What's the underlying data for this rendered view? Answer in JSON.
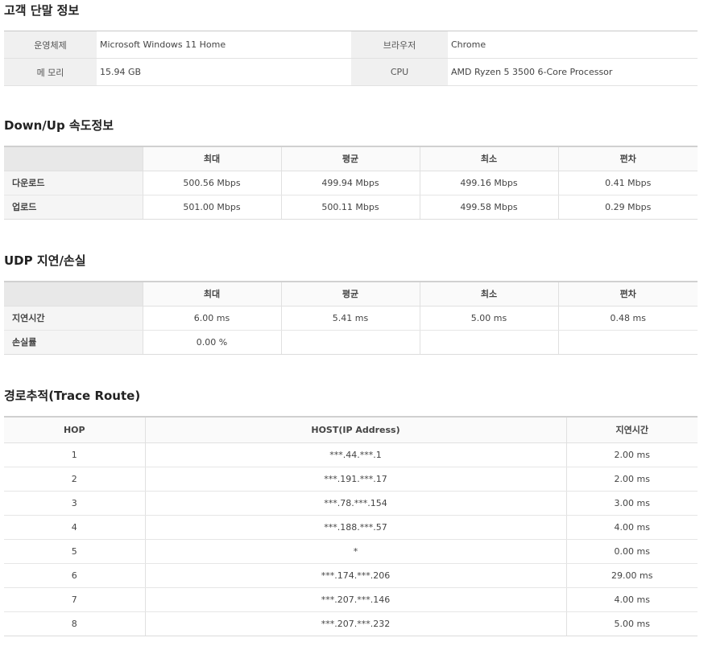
{
  "device": {
    "title": "고객 단말 정보",
    "rows": [
      {
        "k1": "운영체제",
        "v1": "Microsoft Windows 11 Home",
        "k2": "브라우저",
        "v2": "Chrome"
      },
      {
        "k1": "메 모리",
        "v1": "15.94 GB",
        "k2": "CPU",
        "v2": "AMD Ryzen 5 3500 6-Core Processor"
      }
    ]
  },
  "speed": {
    "title": "Down/Up 속도정보",
    "headers": [
      "최대",
      "평균",
      "최소",
      "편차"
    ],
    "rows": [
      {
        "label": "다운로드",
        "values": [
          "500.56 Mbps",
          "499.94 Mbps",
          "499.16 Mbps",
          "0.41 Mbps"
        ]
      },
      {
        "label": "업로드",
        "values": [
          "501.00 Mbps",
          "500.11 Mbps",
          "499.58 Mbps",
          "0.29 Mbps"
        ]
      }
    ]
  },
  "udp": {
    "title": "UDP 지연/손실",
    "headers": [
      "최대",
      "평균",
      "최소",
      "편차"
    ],
    "rows": [
      {
        "label": "지연시간",
        "values": [
          "6.00 ms",
          "5.41 ms",
          "5.00 ms",
          "0.48 ms"
        ]
      },
      {
        "label": "손실률",
        "values": [
          "0.00 %",
          "",
          "",
          ""
        ]
      }
    ]
  },
  "trace": {
    "title": "경로추적(Trace Route)",
    "headers": [
      "HOP",
      "HOST(IP Address)",
      "지연시간"
    ],
    "rows": [
      {
        "hop": "1",
        "host": "***.44.***.1",
        "latency": "2.00 ms"
      },
      {
        "hop": "2",
        "host": "***.191.***.17",
        "latency": "2.00 ms"
      },
      {
        "hop": "3",
        "host": "***.78.***.154",
        "latency": "3.00 ms"
      },
      {
        "hop": "4",
        "host": "***.188.***.57",
        "latency": "4.00 ms"
      },
      {
        "hop": "5",
        "host": "*",
        "latency": "0.00 ms"
      },
      {
        "hop": "6",
        "host": "***.174.***.206",
        "latency": "29.00 ms"
      },
      {
        "hop": "7",
        "host": "***.207.***.146",
        "latency": "4.00 ms"
      },
      {
        "hop": "8",
        "host": "***.207.***.232",
        "latency": "5.00 ms"
      }
    ]
  }
}
